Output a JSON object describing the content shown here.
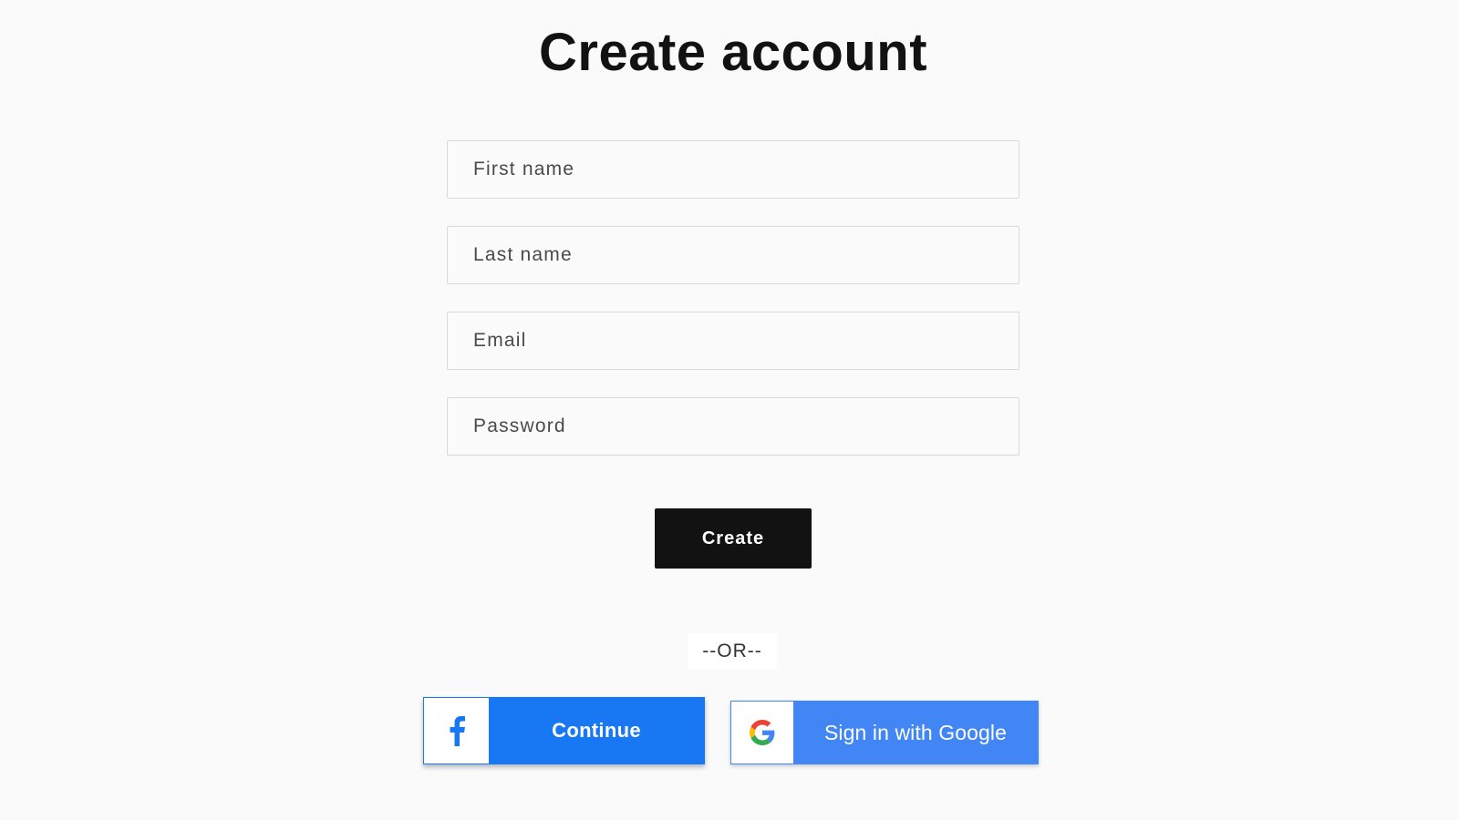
{
  "page": {
    "title": "Create account"
  },
  "form": {
    "fields": [
      {
        "placeholder": "First name",
        "value": ""
      },
      {
        "placeholder": "Last name",
        "value": ""
      },
      {
        "placeholder": "Email",
        "value": ""
      },
      {
        "placeholder": "Password",
        "value": ""
      }
    ],
    "submit_label": "Create"
  },
  "separator": {
    "text": "--OR--"
  },
  "social": {
    "facebook": {
      "label": "Continue",
      "icon": "facebook-icon",
      "color": "#1877f2"
    },
    "google": {
      "label": "Sign in with Google",
      "icon": "google-icon",
      "color": "#4285f4"
    }
  },
  "colors": {
    "background": "#fafafa",
    "primary_button": "#121212",
    "field_border": "#d9d9d9"
  }
}
